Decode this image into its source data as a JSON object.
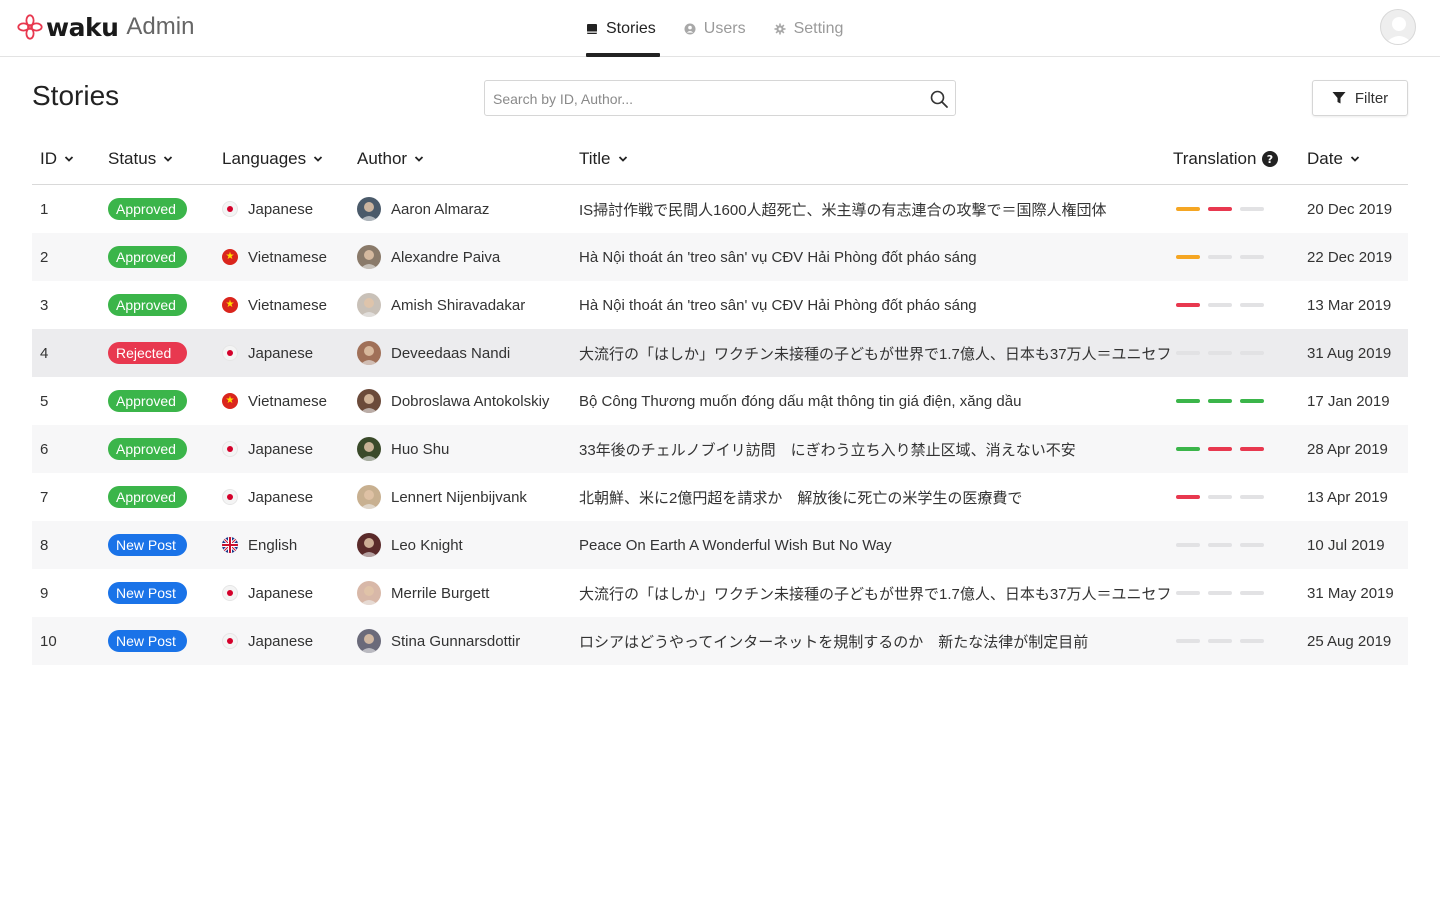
{
  "header": {
    "brand": "waku",
    "product": "Admin",
    "nav": [
      {
        "label": "Stories",
        "icon": "book-icon",
        "active": true
      },
      {
        "label": "Users",
        "icon": "user-circle-icon",
        "active": false
      },
      {
        "label": "Setting",
        "icon": "gear-icon",
        "active": false
      }
    ]
  },
  "page": {
    "title": "Stories",
    "search_placeholder": "Search by ID, Author...",
    "filter_label": "Filter"
  },
  "table": {
    "columns": [
      "ID",
      "Status",
      "Languages",
      "Author",
      "Title",
      "Translation",
      "Date"
    ],
    "rows": [
      {
        "id": "1",
        "status": "Approved",
        "language": "Japanese",
        "author": "Aaron Almaraz",
        "title": "IS掃討作戦で民間人1600人超死亡、米主導の有志連合の攻撃で＝国際人権団体",
        "translation": [
          "orange",
          "red",
          "gray"
        ],
        "date": "20 Dec 2019"
      },
      {
        "id": "2",
        "status": "Approved",
        "language": "Vietnamese",
        "author": "Alexandre Paiva",
        "title": "Hà Nội thoát án 'treo sân' vụ CĐV Hải Phòng đốt pháo sáng",
        "translation": [
          "orange",
          "gray",
          "gray"
        ],
        "date": "22 Dec 2019"
      },
      {
        "id": "3",
        "status": "Approved",
        "language": "Vietnamese",
        "author": "Amish Shiravadakar",
        "title": "Hà Nội thoát án 'treo sân' vụ CĐV Hải Phòng đốt pháo sáng",
        "translation": [
          "red",
          "gray",
          "gray"
        ],
        "date": "13 Mar 2019"
      },
      {
        "id": "4",
        "status": "Rejected",
        "language": "Japanese",
        "author": "Deveedaas Nandi",
        "title": "大流行の「はしか」ワクチン未接種の子どもが世界で1.7億人、日本も37万人＝ユニセフ",
        "translation": [
          "gray",
          "gray",
          "gray"
        ],
        "date": "31 Aug 2019"
      },
      {
        "id": "5",
        "status": "Approved",
        "language": "Vietnamese",
        "author": "Dobroslawa Antokolskiy",
        "title": "Bộ Công Thương muốn đóng dấu mật thông tin giá điện, xăng dầu",
        "translation": [
          "green",
          "green",
          "green"
        ],
        "date": "17 Jan 2019"
      },
      {
        "id": "6",
        "status": "Approved",
        "language": "Japanese",
        "author": "Huo Shu",
        "title": "33年後のチェルノブイリ訪問　にぎわう立ち入り禁止区域、消えない不安",
        "translation": [
          "green",
          "red",
          "red"
        ],
        "date": "28 Apr 2019"
      },
      {
        "id": "7",
        "status": "Approved",
        "language": "Japanese",
        "author": "Lennert Nijenbijvank",
        "title": "北朝鮮、米に2億円超を請求か　解放後に死亡の米学生の医療費で",
        "translation": [
          "red",
          "gray",
          "gray"
        ],
        "date": "13 Apr 2019"
      },
      {
        "id": "8",
        "status": "New Post",
        "language": "English",
        "author": "Leo Knight",
        "title": "Peace On Earth A Wonderful Wish But No Way",
        "translation": [
          "gray",
          "gray",
          "gray"
        ],
        "date": "10 Jul 2019"
      },
      {
        "id": "9",
        "status": "New Post",
        "language": "Japanese",
        "author": "Merrile Burgett",
        "title": "大流行の「はしか」ワクチン未接種の子どもが世界で1.7億人、日本も37万人＝ユニセフ",
        "translation": [
          "gray",
          "gray",
          "gray"
        ],
        "date": "31 May 2019"
      },
      {
        "id": "10",
        "status": "New Post",
        "language": "Japanese",
        "author": "Stina Gunnarsdottir",
        "title": "ロシアはどうやってインターネットを規制するのか　新たな法律が制定目前",
        "translation": [
          "gray",
          "gray",
          "gray"
        ],
        "date": "25 Aug 2019"
      }
    ]
  },
  "colors": {
    "approved": "#3bb54a",
    "rejected": "#e8384f",
    "new_post": "#1a73e8",
    "bar_orange": "#f5a623",
    "bar_red": "#e8384f",
    "bar_green": "#3bb54a",
    "bar_gray": "#e2e2e4",
    "brand_flower": "#e8384f"
  }
}
